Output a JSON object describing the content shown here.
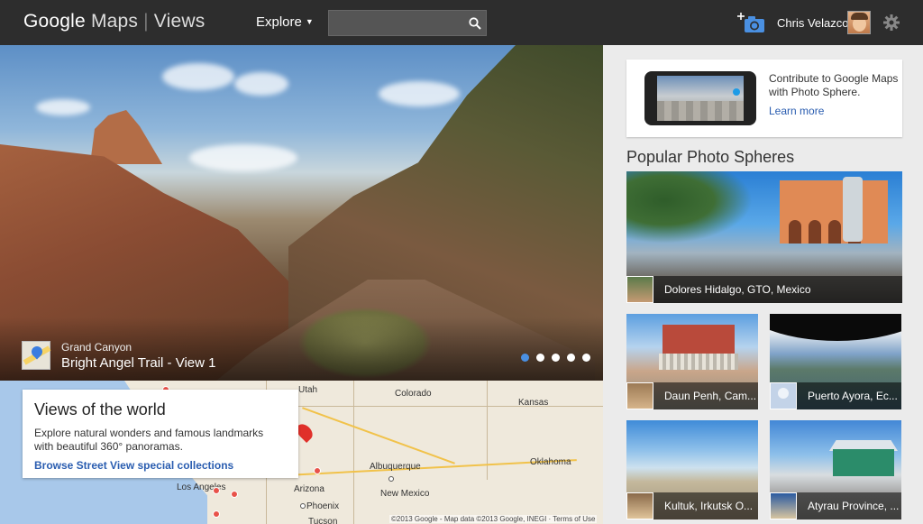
{
  "header": {
    "logo_brand": "Google",
    "logo_product": "Maps",
    "logo_section": "Views",
    "explore_label": "Explore",
    "search_placeholder": "",
    "user_name": "Chris Velazco"
  },
  "hero": {
    "place": "Grand Canyon",
    "title": "Bright Angel Trail - View 1",
    "slides": 5,
    "active_slide": 1
  },
  "map": {
    "labels": {
      "utah": "Utah",
      "colorado": "Colorado",
      "kansas": "Kansas",
      "los_angeles": "Los Angeles",
      "arizona": "Arizona",
      "albuquerque": "Albuquerque",
      "oklahoma": "Oklahoma",
      "new_mexico": "New Mexico",
      "phoenix": "Phoenix",
      "tucson": "Tucson"
    },
    "copyright": "©2013 Google - Map data ©2013 Google, INEGI · Terms of Use"
  },
  "views_card": {
    "heading": "Views of the world",
    "description": "Explore natural wonders and famous landmarks with beautiful 360° panoramas.",
    "link": "Browse Street View special collections"
  },
  "contribute": {
    "text": "Contribute to Google Maps with Photo Sphere.",
    "link": "Learn more"
  },
  "popular": {
    "heading": "Popular Photo Spheres",
    "items": [
      {
        "label": "Dolores Hidalgo, GTO, Mexico"
      },
      {
        "label": "Daun Penh, Cam..."
      },
      {
        "label": "Puerto Ayora, Ec..."
      },
      {
        "label": "Kultuk, Irkutsk O..."
      },
      {
        "label": "Atyrau Province, ..."
      }
    ]
  },
  "colors": {
    "topbar": "#2d2d2d",
    "link": "#2a5db0",
    "active_dot": "#4a90e2",
    "map_marker": "#e0302a"
  },
  "icons": {
    "search": "search-icon",
    "camera": "add-photo-camera-icon",
    "settings": "gear-icon",
    "map_pin": "maps-pin-icon"
  }
}
